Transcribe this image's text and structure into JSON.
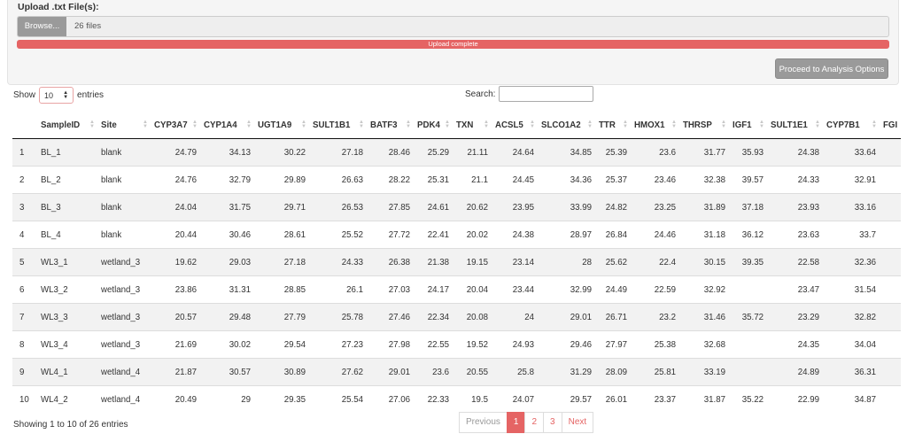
{
  "upload": {
    "label": "Upload .txt File(s):",
    "browse_label": "Browse...",
    "file_text": "26 files",
    "progress_text": "Upload complete",
    "progress": 1.0,
    "proceed_label": "Proceed to Analysis Options"
  },
  "length": {
    "show": "Show",
    "value": "10",
    "entries": "entries"
  },
  "search": {
    "label": "Search:",
    "value": ""
  },
  "table": {
    "columns": [
      "",
      "SampleID",
      "Site",
      "CYP3A7",
      "CYP1A4",
      "UGT1A9",
      "SULT1B1",
      "BATF3",
      "PDK4",
      "TXN",
      "ACSL5",
      "SLCO1A2",
      "TTR",
      "HMOX1",
      "THRSP",
      "IGF1",
      "SULT1E1",
      "CYP7B1",
      "FGI"
    ],
    "rows": [
      [
        "1",
        "BL_1",
        "blank",
        "24.79",
        "34.13",
        "30.22",
        "27.18",
        "28.46",
        "25.29",
        "21.11",
        "24.64",
        "34.85",
        "25.39",
        "23.6",
        "31.77",
        "35.93",
        "24.38",
        "33.64",
        ""
      ],
      [
        "2",
        "BL_2",
        "blank",
        "24.76",
        "32.79",
        "29.89",
        "26.63",
        "28.22",
        "25.31",
        "21.1",
        "24.45",
        "34.36",
        "25.37",
        "23.46",
        "32.38",
        "39.57",
        "24.33",
        "32.91",
        ""
      ],
      [
        "3",
        "BL_3",
        "blank",
        "24.04",
        "31.75",
        "29.71",
        "26.53",
        "27.85",
        "24.61",
        "20.62",
        "23.95",
        "33.99",
        "24.82",
        "23.25",
        "31.89",
        "37.18",
        "23.93",
        "33.16",
        ""
      ],
      [
        "4",
        "BL_4",
        "blank",
        "20.44",
        "30.46",
        "28.61",
        "25.52",
        "27.72",
        "22.41",
        "20.02",
        "24.38",
        "28.97",
        "26.84",
        "24.46",
        "31.18",
        "36.12",
        "23.63",
        "33.7",
        ""
      ],
      [
        "5",
        "WL3_1",
        "wetland_3",
        "19.62",
        "29.03",
        "27.18",
        "24.33",
        "26.38",
        "21.38",
        "19.15",
        "23.14",
        "28",
        "25.62",
        "22.4",
        "30.15",
        "39.35",
        "22.58",
        "32.36",
        ""
      ],
      [
        "6",
        "WL3_2",
        "wetland_3",
        "23.86",
        "31.31",
        "28.85",
        "26.1",
        "27.03",
        "24.17",
        "20.04",
        "23.44",
        "32.99",
        "24.49",
        "22.59",
        "32.92",
        "",
        "23.47",
        "31.54",
        ""
      ],
      [
        "7",
        "WL3_3",
        "wetland_3",
        "20.57",
        "29.48",
        "27.79",
        "25.78",
        "27.46",
        "22.34",
        "20.08",
        "24",
        "29.01",
        "26.71",
        "23.2",
        "31.46",
        "35.72",
        "23.29",
        "32.82",
        ""
      ],
      [
        "8",
        "WL3_4",
        "wetland_3",
        "21.69",
        "30.02",
        "29.54",
        "27.23",
        "27.98",
        "22.55",
        "19.52",
        "24.93",
        "29.46",
        "27.97",
        "25.38",
        "32.68",
        "",
        "24.35",
        "34.04",
        ""
      ],
      [
        "9",
        "WL4_1",
        "wetland_4",
        "21.87",
        "30.57",
        "30.89",
        "27.62",
        "29.01",
        "23.6",
        "20.55",
        "25.8",
        "31.29",
        "28.09",
        "25.81",
        "33.19",
        "",
        "24.89",
        "36.31",
        ""
      ],
      [
        "10",
        "WL4_2",
        "wetland_4",
        "20.49",
        "29",
        "29.35",
        "25.54",
        "27.06",
        "22.33",
        "19.5",
        "24.07",
        "29.57",
        "26.01",
        "23.37",
        "31.87",
        "35.22",
        "22.99",
        "34.87",
        ""
      ]
    ]
  },
  "info": "Showing 1 to 10 of 26 entries",
  "pagination": {
    "previous": "Previous",
    "pages": [
      "1",
      "2",
      "3"
    ],
    "active_page": "1",
    "next": "Next"
  },
  "colors": {
    "accent": "#e56464",
    "button_gray": "#9a9a9a"
  }
}
